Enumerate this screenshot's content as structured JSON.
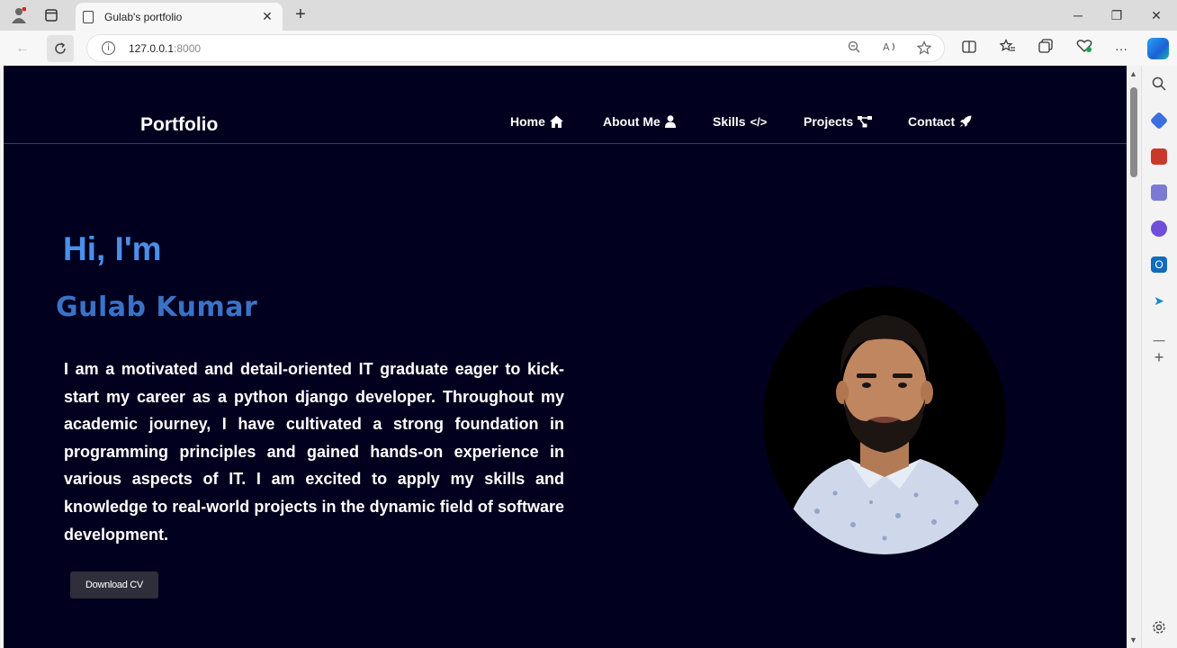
{
  "browser": {
    "tab_title": "Gulab's portfolio",
    "tab_close": "✕",
    "new_tab": "+",
    "url_host": "127.0.0.1",
    "url_port": ":8000",
    "window_controls": {
      "minimize": "─",
      "restore": "❐",
      "close": "✕"
    },
    "more": "···"
  },
  "page": {
    "brand": "Portfolio",
    "nav": [
      {
        "label": "Home",
        "icon": "house-icon",
        "glyph": "⌂"
      },
      {
        "label": "About Me",
        "icon": "user-icon",
        "glyph": "●"
      },
      {
        "label": "Skills",
        "icon": "code-icon",
        "glyph": "</>"
      },
      {
        "label": "Projects",
        "icon": "project-diagram-icon",
        "glyph": "⚙"
      },
      {
        "label": "Contact",
        "icon": "rocket-icon",
        "glyph": "🚀"
      }
    ],
    "hero": {
      "greeting": "Hi, I'm",
      "name": "Gulab Kumar",
      "bio": "I am a motivated and detail-oriented IT graduate eager to kick-start my career as a python django developer. Throughout my academic journey, I have cultivated a strong foundation in programming principles and gained hands-on experience in various aspects of IT. I am excited to apply my skills and knowledge to real-world projects in the dynamic field of software development.",
      "cv_button": "Download CV"
    }
  },
  "colors": {
    "page_background": "#01001f",
    "greeting": "#4b8fe8",
    "name": "#3b72c6",
    "button": "#2f2f3c"
  }
}
